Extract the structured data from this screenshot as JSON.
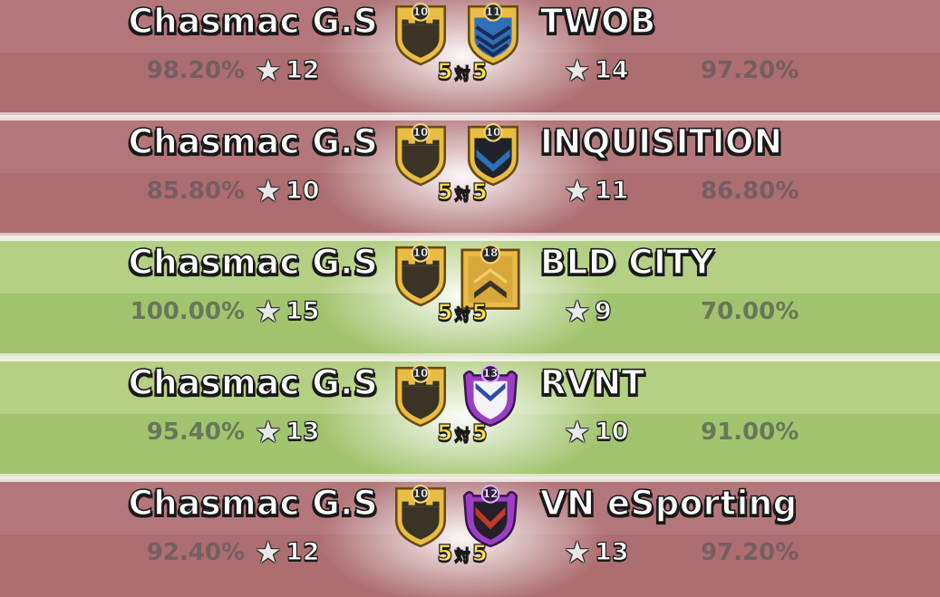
{
  "wars": [
    {
      "result": "lose",
      "clan_name": "Chasmac G.S",
      "clan_level": "10",
      "clan_destruction": "98.20%",
      "clan_stars": "12",
      "versus": {
        "left": "5",
        "sep": "対",
        "right": "5"
      },
      "opponent_name": "TWOB",
      "opponent_level": "11",
      "opponent_badge": "blue-chevron-badge",
      "opponent_stars": "14",
      "opponent_destruction": "97.20%"
    },
    {
      "result": "lose",
      "clan_name": "Chasmac G.S",
      "clan_level": "10",
      "clan_destruction": "85.80%",
      "clan_stars": "10",
      "versus": {
        "left": "5",
        "sep": "対",
        "right": "5"
      },
      "opponent_name": "INQUISITION",
      "opponent_level": "10",
      "opponent_badge": "dark-chevron-badge",
      "opponent_stars": "11",
      "opponent_destruction": "86.80%"
    },
    {
      "result": "win",
      "clan_name": "Chasmac G.S",
      "clan_level": "10",
      "clan_destruction": "100.00%",
      "clan_stars": "15",
      "versus": {
        "left": "5",
        "sep": "対",
        "right": "5"
      },
      "opponent_name": "BLD CITY",
      "opponent_level": "18",
      "opponent_badge": "gold-banner-badge",
      "opponent_stars": "9",
      "opponent_destruction": "70.00%"
    },
    {
      "result": "win",
      "clan_name": "Chasmac G.S",
      "clan_level": "10",
      "clan_destruction": "95.40%",
      "clan_stars": "13",
      "versus": {
        "left": "5",
        "sep": "対",
        "right": "5"
      },
      "opponent_name": "RVNT",
      "opponent_level": "13",
      "opponent_badge": "purple-winged-badge",
      "opponent_stars": "10",
      "opponent_destruction": "91.00%"
    },
    {
      "result": "lose",
      "clan_name": "Chasmac G.S",
      "clan_level": "10",
      "clan_destruction": "92.40%",
      "clan_stars": "12",
      "versus": {
        "left": "5",
        "sep": "対",
        "right": "5"
      },
      "opponent_name": "VN eSporting",
      "opponent_level": "12",
      "opponent_badge": "purple-winged-dark-badge",
      "opponent_stars": "13",
      "opponent_destruction": "97.20%"
    }
  ],
  "colors": {
    "lose_row": "#ad6e71",
    "win_row": "#a3c46f",
    "versus_text": "#ffe14a",
    "badge_gold": "#e9bd45"
  },
  "icons": {
    "star": "★",
    "clan_badge": "gold-castle-badge"
  }
}
